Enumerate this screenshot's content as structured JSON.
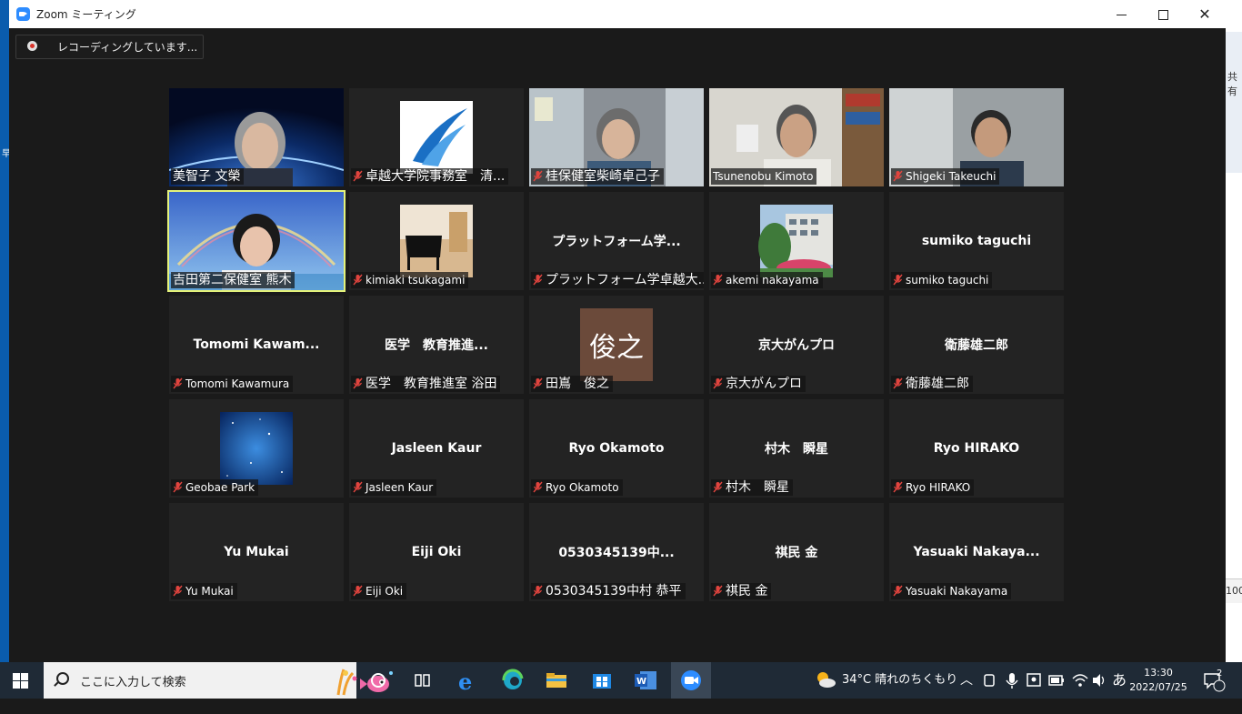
{
  "window": {
    "title": "Zoom ミーティング",
    "recording_label": "レコーディングしています..."
  },
  "desktop": {
    "right_edge_text": "共有",
    "right_edge_number": "100",
    "left_edge_text": "早"
  },
  "participants": [
    {
      "id": "p1",
      "name_label": "美智子 文榮",
      "center_name": "",
      "muted": false,
      "kind": "video"
    },
    {
      "id": "p2",
      "name_label": "卓越大学院事務室　清...",
      "center_name": "",
      "muted": true,
      "kind": "logo"
    },
    {
      "id": "p3",
      "name_label": "桂保健室柴崎卓己子",
      "center_name": "",
      "muted": true,
      "kind": "video"
    },
    {
      "id": "p4",
      "name_label": "Tsunenobu Kimoto",
      "center_name": "",
      "muted": false,
      "kind": "video"
    },
    {
      "id": "p5",
      "name_label": "Shigeki Takeuchi",
      "center_name": "",
      "muted": true,
      "kind": "video"
    },
    {
      "id": "p6",
      "name_label": "吉田第二保健室 熊木",
      "center_name": "",
      "muted": false,
      "kind": "video",
      "active": true
    },
    {
      "id": "p7",
      "name_label": "kimiaki tsukagami",
      "center_name": "",
      "muted": true,
      "kind": "piano"
    },
    {
      "id": "p8",
      "name_label": "プラットフォーム学卓越大...",
      "center_name": "プラットフォーム学...",
      "muted": true,
      "kind": "name"
    },
    {
      "id": "p9",
      "name_label": "akemi nakayama",
      "center_name": "",
      "muted": true,
      "kind": "building"
    },
    {
      "id": "p10",
      "name_label": "sumiko  taguchi",
      "center_name": "sumiko  taguchi",
      "muted": true,
      "kind": "name"
    },
    {
      "id": "p11",
      "name_label": "Tomomi Kawamura",
      "center_name": "Tomomi  Kawam...",
      "muted": true,
      "kind": "name"
    },
    {
      "id": "p12",
      "name_label": "医学　教育推進室 浴田",
      "center_name": "医学　教育推進...",
      "muted": true,
      "kind": "name"
    },
    {
      "id": "p13",
      "name_label": "田嶌　俊之",
      "center_name": "俊之",
      "muted": true,
      "kind": "initial"
    },
    {
      "id": "p14",
      "name_label": "京大がんプロ",
      "center_name": "京大がんプロ",
      "muted": true,
      "kind": "name"
    },
    {
      "id": "p15",
      "name_label": "衛藤雄二郎",
      "center_name": "衛藤雄二郎",
      "muted": true,
      "kind": "name"
    },
    {
      "id": "p16",
      "name_label": "Geobae Park",
      "center_name": "",
      "muted": true,
      "kind": "space"
    },
    {
      "id": "p17",
      "name_label": "Jasleen Kaur",
      "center_name": "Jasleen Kaur",
      "muted": true,
      "kind": "name"
    },
    {
      "id": "p18",
      "name_label": "Ryo Okamoto",
      "center_name": "Ryo Okamoto",
      "muted": true,
      "kind": "name"
    },
    {
      "id": "p19",
      "name_label": "村木　瞬星",
      "center_name": "村木　瞬星",
      "muted": true,
      "kind": "name"
    },
    {
      "id": "p20",
      "name_label": "Ryo HIRAKO",
      "center_name": "Ryo HIRAKO",
      "muted": true,
      "kind": "name"
    },
    {
      "id": "p21",
      "name_label": "Yu Mukai",
      "center_name": "Yu Mukai",
      "muted": true,
      "kind": "name"
    },
    {
      "id": "p22",
      "name_label": "Eiji Oki",
      "center_name": "Eiji Oki",
      "muted": true,
      "kind": "name"
    },
    {
      "id": "p23",
      "name_label": "0530345139中村 恭平",
      "center_name": "0530345139中...",
      "muted": true,
      "kind": "name"
    },
    {
      "id": "p24",
      "name_label": "祺民 金",
      "center_name": "祺民 金",
      "muted": true,
      "kind": "name"
    },
    {
      "id": "p25",
      "name_label": "Yasuaki Nakayama",
      "center_name": "Yasuaki  Nakaya...",
      "muted": true,
      "kind": "name"
    }
  ],
  "taskbar": {
    "search_placeholder": "ここに入力して検索",
    "weather": "34°C  晴れのちくもり",
    "ime": "あ",
    "time": "13:30",
    "date": "2022/07/25",
    "notification_count": "2"
  },
  "colors": {
    "active_speaker": "#e4f27a",
    "muted_icon": "#e0443e",
    "zoom_blue": "#2d8cff",
    "initial_tile": "#6b4a3a"
  }
}
